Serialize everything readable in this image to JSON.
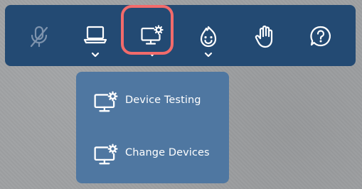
{
  "colors": {
    "toolbar_background": "#234a73",
    "dropdown_background": "#4f77a1",
    "highlight_ring": "#f26b6b",
    "icon": "#ffffff",
    "page_background": "#9fa1a3"
  },
  "toolbar": {
    "buttons": [
      {
        "icon": "microphone-muted-icon",
        "has_caret": false
      },
      {
        "icon": "laptop-icon",
        "has_caret": true
      },
      {
        "icon": "monitor-settings-icon",
        "has_caret": true,
        "selected": true
      },
      {
        "icon": "face-emoji-icon",
        "has_caret": true
      },
      {
        "icon": "raise-hand-icon",
        "has_caret": false
      },
      {
        "icon": "help-question-icon",
        "has_caret": false
      }
    ]
  },
  "device_menu": {
    "items": [
      {
        "label": "Device Testing",
        "icon": "monitor-settings-icon"
      },
      {
        "label": "Change Devices",
        "icon": "monitor-settings-icon"
      }
    ]
  }
}
